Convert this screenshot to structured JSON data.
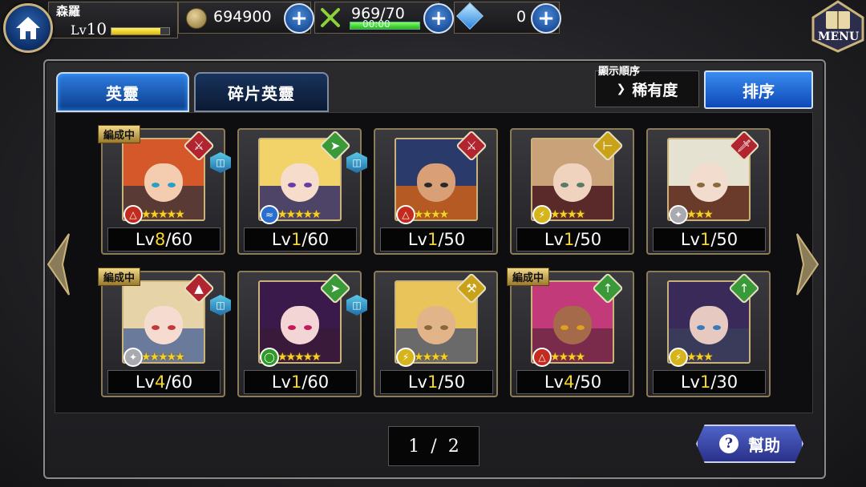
{
  "player": {
    "name": "森羅",
    "level_prefix": "Lv",
    "level": "10",
    "exp_fraction": 0.85
  },
  "resources": {
    "coins": "694900",
    "stamina": "969/70",
    "stamina_timer": "00:00",
    "stamina_fraction": 1.0,
    "gems": "0"
  },
  "menu_label": "MENU",
  "tabs": [
    {
      "label": "英靈",
      "active": true
    },
    {
      "label": "碎片英靈",
      "active": false
    }
  ],
  "sort": {
    "title": "顯示順序",
    "value": "稀有度",
    "button_label": "排序"
  },
  "cards": [
    {
      "tag": "編成中",
      "level": "8",
      "max": "/60",
      "stars": 5,
      "class_icon": "sword-shield-icon",
      "class_color": "#b0252f",
      "element_icon": "fire-icon",
      "element_color": "#c42a1d",
      "book": true,
      "hair": "#d5582a",
      "skin": "#f4cdb0",
      "eye": "#2aa0c8",
      "bg": "#5a3a34"
    },
    {
      "tag": "",
      "level": "1",
      "max": "/60",
      "stars": 5,
      "class_icon": "bow-icon",
      "class_color": "#3a9a3a",
      "element_icon": "water-icon",
      "element_color": "#2a6fd0",
      "book": true,
      "hair": "#f1d36a",
      "skin": "#f6dccb",
      "eye": "#6a3aa8",
      "bg": "#4d4468"
    },
    {
      "tag": "",
      "level": "1",
      "max": "/50",
      "stars": 4,
      "class_icon": "crossed-swords-icon",
      "class_color": "#b0252f",
      "element_icon": "fire-icon",
      "element_color": "#c42a1d",
      "book": false,
      "hair": "#2a3a6a",
      "skin": "#d9a077",
      "eye": "#2a2a2a",
      "bg": "#b55a22"
    },
    {
      "tag": "",
      "level": "1",
      "max": "/50",
      "stars": 4,
      "class_icon": "gun-icon",
      "class_color": "#c9a21a",
      "element_icon": "lightning-icon",
      "element_color": "#d6b51c",
      "book": false,
      "hair": "#c9a27a",
      "skin": "#f0d3bf",
      "eye": "#5a7a6a",
      "bg": "#5a2a2a"
    },
    {
      "tag": "",
      "level": "1",
      "max": "/50",
      "stars": 3,
      "class_icon": "sword-icon",
      "class_color": "#b0252f",
      "element_icon": "star-icon",
      "element_color": "#a9a9b0",
      "book": false,
      "hair": "#e6e2d2",
      "skin": "#f1dccd",
      "eye": "#8a6a3a",
      "bg": "#6a3a2a"
    },
    {
      "tag": "編成中",
      "level": "4",
      "max": "/60",
      "stars": 5,
      "class_icon": "staff-icon",
      "class_color": "#b0252f",
      "element_icon": "star-icon",
      "element_color": "#a9a9b0",
      "book": true,
      "hair": "#e6d3a8",
      "skin": "#f6dcd0",
      "eye": "#c23a3a",
      "bg": "#6a7a9a"
    },
    {
      "tag": "",
      "level": "1",
      "max": "/60",
      "stars": 5,
      "class_icon": "bow-icon",
      "class_color": "#3a9a3a",
      "element_icon": "wind-icon",
      "element_color": "#2f9a2a",
      "book": true,
      "hair": "#3a1a4a",
      "skin": "#f4d5d5",
      "eye": "#c21a5a",
      "bg": "#3a1a3a"
    },
    {
      "tag": "",
      "level": "1",
      "max": "/50",
      "stars": 4,
      "class_icon": "wrench-icon",
      "class_color": "#c9a21a",
      "element_icon": "lightning-icon",
      "element_color": "#d6b51c",
      "book": false,
      "hair": "#e8c45a",
      "skin": "#e2b48a",
      "eye": "#8a6a3a",
      "bg": "#6a6a6a"
    },
    {
      "tag": "編成中",
      "level": "4",
      "max": "/50",
      "stars": 4,
      "class_icon": "dagger-icon",
      "class_color": "#3a9a3a",
      "element_icon": "fire-icon",
      "element_color": "#c42a1d",
      "book": false,
      "hair": "#c23a7a",
      "skin": "#a56a4a",
      "eye": "#e0a020",
      "bg": "#7a2a4a"
    },
    {
      "tag": "",
      "level": "1",
      "max": "/30",
      "stars": 3,
      "class_icon": "dagger-icon",
      "class_color": "#3a9a3a",
      "element_icon": "lightning-icon",
      "element_color": "#d6b51c",
      "book": false,
      "hair": "#3a2a5a",
      "skin": "#e6c9c0",
      "eye": "#3a7ab8",
      "bg": "#3a3a5a"
    }
  ],
  "pagination": {
    "current": "1",
    "separator": "/",
    "total": "2"
  },
  "help_label": "幫助",
  "colors": {
    "accent_blue": "#1b5fc0",
    "gold_border": "#c9b37a",
    "level_yellow": "#f2d62a"
  }
}
